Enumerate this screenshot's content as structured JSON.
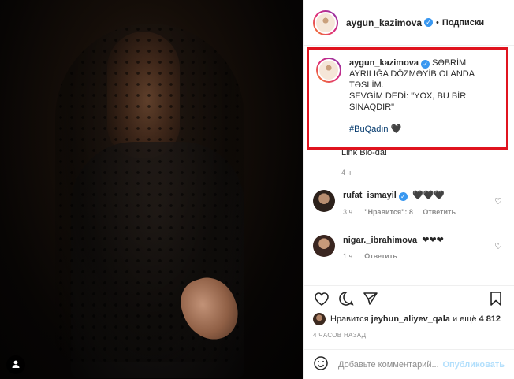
{
  "post": {
    "username": "aygun_kazimova",
    "follow_dot": "•",
    "follow_label": "Подписки",
    "caption_username": "aygun_kazimova",
    "caption_lines": [
      "SƏBRİM",
      "AYRILIĞA DÖZMƏYİB OLANDA",
      "TƏSLİM.",
      "SEVGİM DEDİ: \"YOX, BU BİR",
      "SINAQDIR\""
    ],
    "hashtag": "#BuQadın 🖤",
    "after_caption": "Link Bio-da!",
    "caption_age": "4 ч."
  },
  "comments": [
    {
      "user": "rufat_ismayil",
      "verified": true,
      "text": "🖤🖤🖤",
      "age": "3 ч.",
      "likes": "\"Нравится\": 8",
      "reply": "Ответить"
    },
    {
      "user": "nigar._ibrahimova",
      "verified": false,
      "text": "❤❤❤",
      "age": "1 ч.",
      "likes": "",
      "reply": "Ответить"
    }
  ],
  "likes": {
    "prefix": "Нравится",
    "user": "jeyhun_aliyev_qala",
    "middle": "и ещё",
    "count": "4 812"
  },
  "timestamp": "4 ЧАСОВ НАЗАД",
  "add_comment": {
    "placeholder": "Добавьте комментарий...",
    "publish": "Опубликовать"
  },
  "colors": {
    "verified": "#3897f0",
    "highlight_border": "#e0141f",
    "hashtag": "#00376b"
  },
  "icons": [
    "person-icon",
    "verified-icon",
    "heart-icon",
    "comment-icon",
    "share-icon",
    "bookmark-icon",
    "emoji-icon"
  ]
}
